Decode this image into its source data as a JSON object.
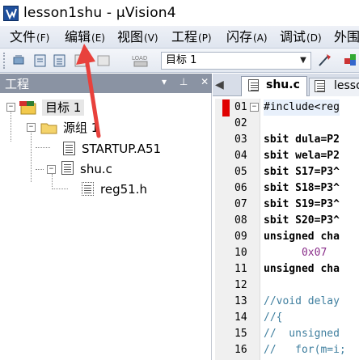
{
  "window": {
    "title": "lesson1shu  - µVision4"
  },
  "menu": [
    {
      "label": "文件",
      "acc": "(F)"
    },
    {
      "label": "编辑",
      "acc": "(E)"
    },
    {
      "label": "视图",
      "acc": "(V)"
    },
    {
      "label": "工程",
      "acc": "(P)"
    },
    {
      "label": "闪存",
      "acc": "(A)"
    },
    {
      "label": "调试",
      "acc": "(D)"
    },
    {
      "label": "外围",
      "acc": ""
    }
  ],
  "toolbar": {
    "target": "目标 1"
  },
  "project_panel": {
    "title": "工程",
    "controls": "▾ ⊥ ✕",
    "tree": {
      "root": "目标 1",
      "group": "源组 1",
      "files": [
        "STARTUP.A51",
        "shu.c"
      ],
      "subfile": "reg51.h"
    }
  },
  "editor": {
    "tabs": [
      "shu.c",
      "lesso"
    ],
    "lines": [
      {
        "n": "01",
        "text": "#include<reg"
      },
      {
        "n": "02",
        "text": ""
      },
      {
        "n": "03",
        "text": "sbit dula=P2"
      },
      {
        "n": "04",
        "text": "sbit wela=P2"
      },
      {
        "n": "05",
        "text": "sbit S17=P3^"
      },
      {
        "n": "06",
        "text": "sbit S18=P3^"
      },
      {
        "n": "07",
        "text": "sbit S19=P3^"
      },
      {
        "n": "08",
        "text": "sbit S20=P3^"
      },
      {
        "n": "09",
        "text": "unsigned cha"
      },
      {
        "n": "10",
        "text": "      0x07"
      },
      {
        "n": "11",
        "text": "unsigned cha"
      },
      {
        "n": "12",
        "text": ""
      },
      {
        "n": "13",
        "text": "//void delay"
      },
      {
        "n": "14",
        "text": "//{"
      },
      {
        "n": "15",
        "text": "//  unsigned"
      },
      {
        "n": "16",
        "text": "//   for(m=i;"
      }
    ]
  },
  "colors": {
    "accent_red": "#e8413c",
    "panel_header": "#8a93a3",
    "menu_bg": "#e6ebf3"
  }
}
